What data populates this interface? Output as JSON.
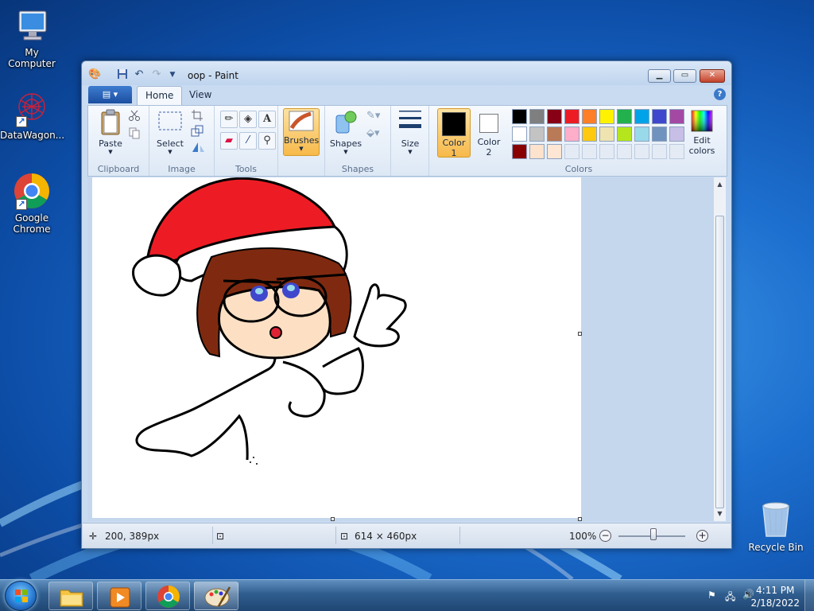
{
  "desktop": {
    "icons": [
      {
        "label": "My Computer",
        "icon": "computer-icon"
      },
      {
        "label": "DataWagon...",
        "icon": "datawagon-icon"
      },
      {
        "label": "Google Chrome",
        "icon": "chrome-icon"
      },
      {
        "label": "Recycle Bin",
        "icon": "recycle-bin-icon"
      }
    ]
  },
  "window": {
    "title": "oop - Paint",
    "tabs": [
      "Home",
      "View"
    ],
    "ribbon": {
      "clipboard": {
        "group": "Clipboard",
        "paste": "Paste"
      },
      "image": {
        "group": "Image",
        "select": "Select"
      },
      "tools": {
        "group": "Tools"
      },
      "brushes": {
        "label": "Brushes"
      },
      "shapes": {
        "group": "Shapes",
        "label": "Shapes"
      },
      "size": {
        "label": "Size"
      },
      "colors": {
        "group": "Colors",
        "color1_line1": "Color",
        "color1_line2": "1",
        "color2_line1": "Color",
        "color2_line2": "2",
        "edit_line1": "Edit",
        "edit_line2": "colors",
        "color1": "#000000",
        "color2": "#ffffff",
        "palette": [
          "#000000",
          "#7f7f7f",
          "#880015",
          "#ed1c24",
          "#ff7f27",
          "#fff200",
          "#22b14c",
          "#00a2e8",
          "#3f48cc",
          "#a349a4",
          "#ffffff",
          "#c3c3c3",
          "#b97a57",
          "#ffaec9",
          "#ffc90e",
          "#efe4b0",
          "#b5e61d",
          "#99d9ea",
          "#7092be",
          "#c8bfe7",
          "#880000",
          "#fde2cd",
          "#fde7d4",
          "",
          "",
          "",
          "",
          "",
          "",
          ""
        ]
      }
    },
    "status": {
      "cursor_pos": "200, 389px",
      "image_size": "614 × 460px",
      "zoom": "100%"
    }
  },
  "taskbar": {
    "time": "4:11 PM",
    "date": "2/18/2022"
  }
}
